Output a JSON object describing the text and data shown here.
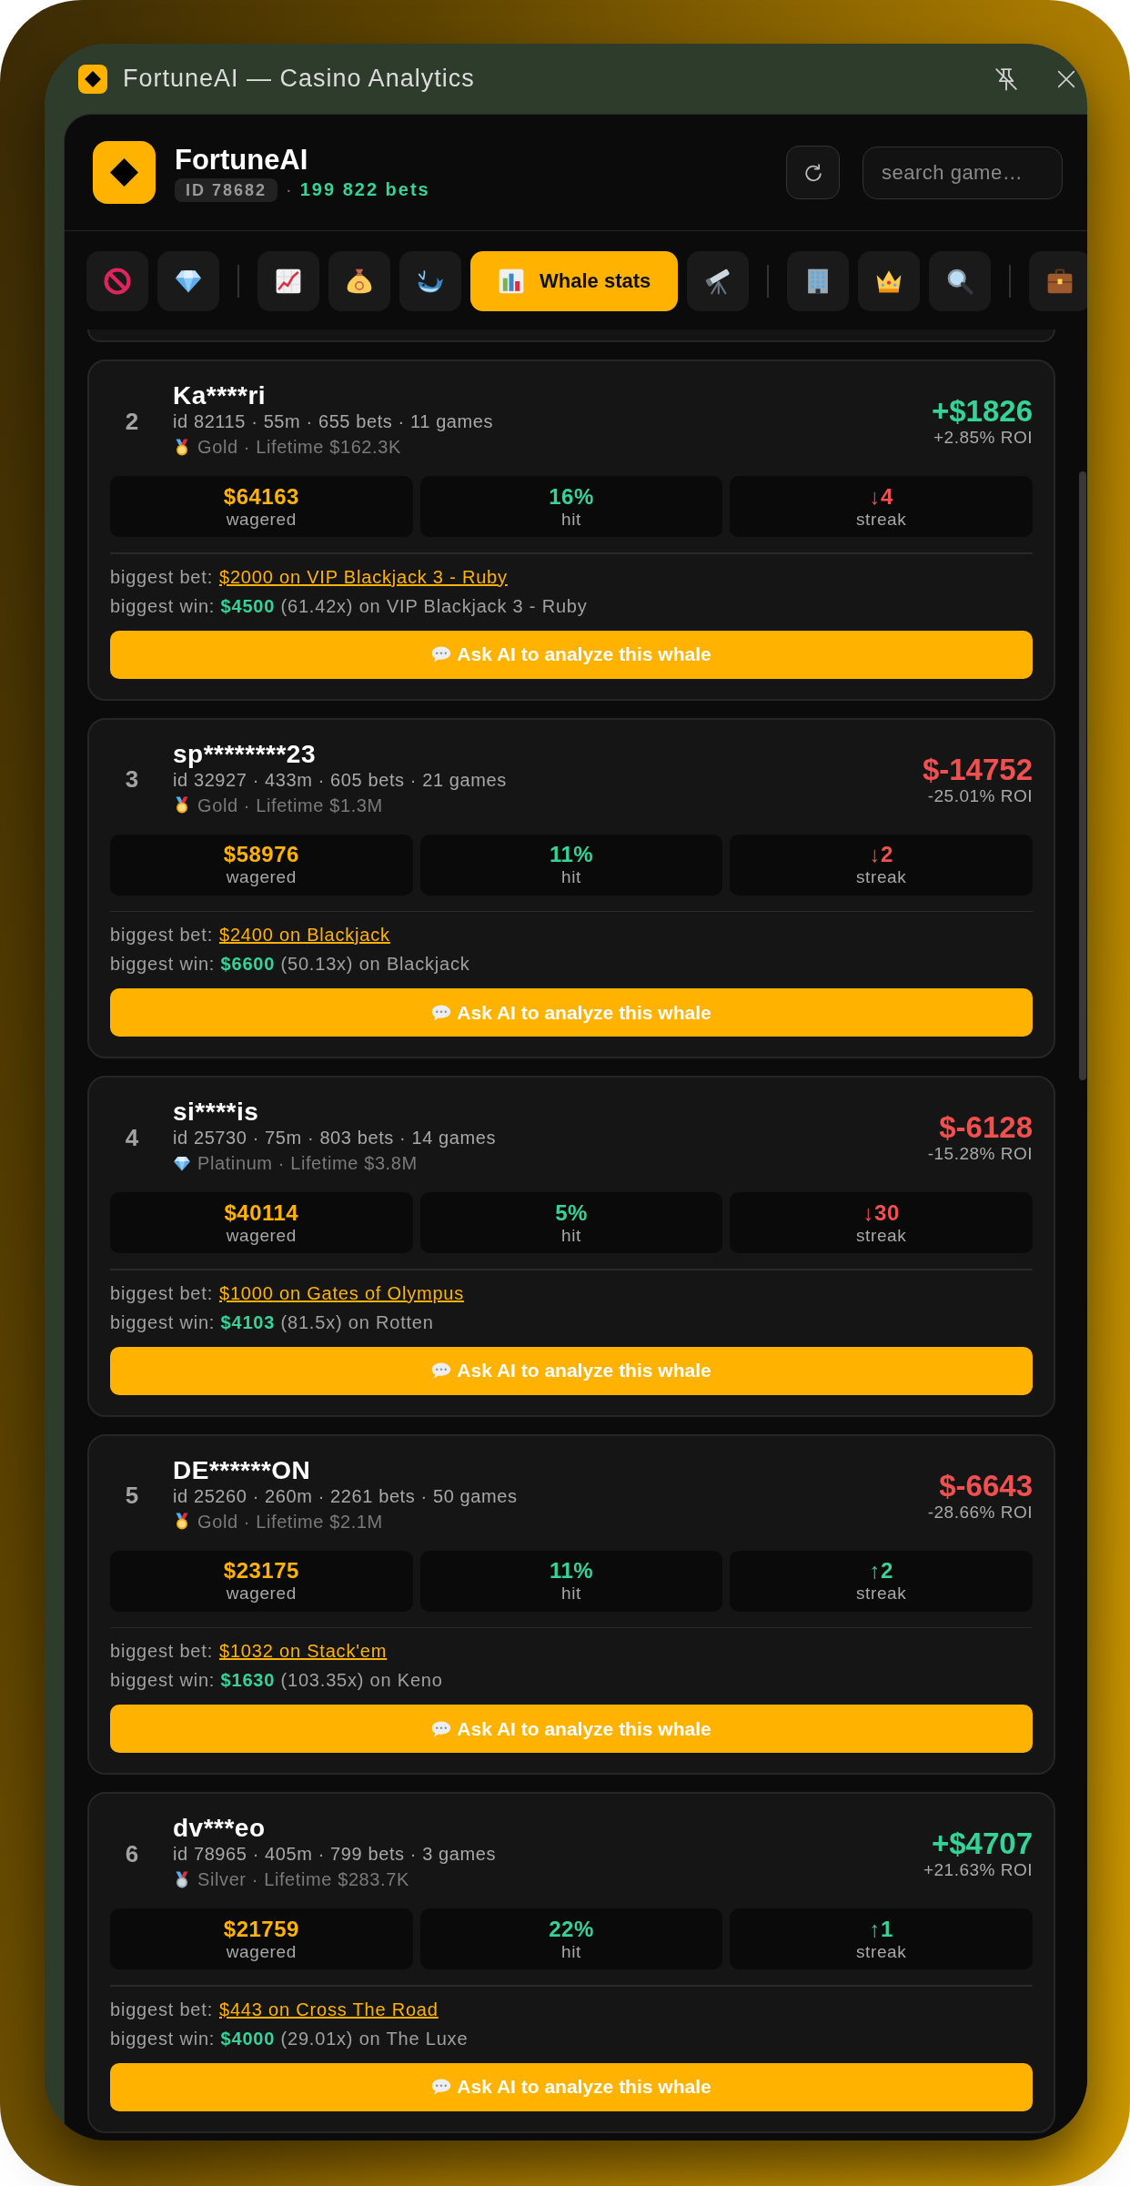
{
  "window": {
    "title": "FortuneAI — Casino Analytics"
  },
  "header": {
    "app_name": "FortuneAI",
    "id_badge": "ID 78682",
    "separator": "·",
    "bets": "199 822 bets",
    "search": {
      "placeholder": "search game…"
    }
  },
  "tab_groups": [
    {
      "tabs": [
        {
          "selected": false
        },
        {
          "selected": false
        }
      ]
    },
    {
      "tabs": [
        {
          "selected": false
        },
        {
          "selected": false
        },
        {
          "selected": false
        },
        {
          "label": "Whale stats",
          "selected": true
        },
        {
          "selected": false
        }
      ]
    },
    {
      "tabs": [
        {
          "selected": false
        },
        {
          "selected": false
        },
        {
          "selected": false
        }
      ]
    },
    {
      "tabs": [
        {
          "selected": false
        }
      ]
    }
  ],
  "whales": [
    {
      "rank": "2",
      "name": "Ka****ri",
      "meta": "id 82115 · 55m · 655 bets · 11 games",
      "tier": {
        "kind": "gold",
        "text": "Gold · Lifetime $162.3K"
      },
      "positive": true,
      "profit": "+$1826",
      "roi": "+2.85% ROI",
      "stats": [
        {
          "kind": "wagered",
          "value": "$64163",
          "label": "wagered"
        },
        {
          "kind": "hit",
          "value": "16%",
          "label": "hit"
        },
        {
          "kind": "streak",
          "rising": false,
          "value": "↓4",
          "label": "streak"
        }
      ],
      "biggest_bet": {
        "label": "biggest bet:",
        "link": "$2000 on VIP Blackjack 3 - Ruby"
      },
      "biggest_win": "biggest win: **$4500** (61.42x) on VIP Blackjack 3 - Ruby",
      "button": "Ask AI to analyze this whale"
    },
    {
      "rank": "3",
      "name": "sp********23",
      "meta": "id 32927 · 433m · 605 bets · 21 games",
      "tier": {
        "kind": "gold",
        "text": "Gold · Lifetime $1.3M"
      },
      "positive": false,
      "profit": "$-14752",
      "roi": "-25.01% ROI",
      "stats": [
        {
          "kind": "wagered",
          "value": "$58976",
          "label": "wagered"
        },
        {
          "kind": "hit",
          "value": "11%",
          "label": "hit"
        },
        {
          "kind": "streak",
          "rising": false,
          "value": "↓2",
          "label": "streak"
        }
      ],
      "biggest_bet": {
        "label": "biggest bet:",
        "link": "$2400 on Blackjack"
      },
      "biggest_win": "biggest win: **$6600** (50.13x) on Blackjack",
      "button": "Ask AI to analyze this whale"
    },
    {
      "rank": "4",
      "name": "si****is",
      "meta": "id 25730 · 75m · 803 bets · 14 games",
      "tier": {
        "kind": "platinum",
        "text": "Platinum · Lifetime $3.8M"
      },
      "positive": false,
      "profit": "$-6128",
      "roi": "-15.28% ROI",
      "stats": [
        {
          "kind": "wagered",
          "value": "$40114",
          "label": "wagered"
        },
        {
          "kind": "hit",
          "value": "5%",
          "label": "hit"
        },
        {
          "kind": "streak",
          "rising": false,
          "value": "↓30",
          "label": "streak"
        }
      ],
      "biggest_bet": {
        "label": "biggest bet:",
        "link": "$1000 on Gates of Olympus"
      },
      "biggest_win": "biggest win: **$4103** (81.5x) on Rotten",
      "button": "Ask AI to analyze this whale"
    },
    {
      "rank": "5",
      "name": "DE******ON",
      "meta": "id 25260 · 260m · 2261 bets · 50 games",
      "tier": {
        "kind": "gold",
        "text": "Gold · Lifetime $2.1M"
      },
      "positive": false,
      "profit": "$-6643",
      "roi": "-28.66% ROI",
      "stats": [
        {
          "kind": "wagered",
          "value": "$23175",
          "label": "wagered"
        },
        {
          "kind": "hit",
          "value": "11%",
          "label": "hit"
        },
        {
          "kind": "streak",
          "rising": true,
          "value": "↑2",
          "label": "streak"
        }
      ],
      "biggest_bet": {
        "label": "biggest bet:",
        "link": "$1032 on Stack'em"
      },
      "biggest_win": "biggest win: **$1630** (103.35x) on Keno",
      "button": "Ask AI to analyze this whale"
    },
    {
      "rank": "6",
      "name": "dv***eo",
      "meta": "id 78965 · 405m · 799 bets · 3 games",
      "tier": {
        "kind": "silver",
        "text": "Silver · Lifetime $283.7K"
      },
      "positive": true,
      "profit": "+$4707",
      "roi": "+21.63% ROI",
      "stats": [
        {
          "kind": "wagered",
          "value": "$21759",
          "label": "wagered"
        },
        {
          "kind": "hit",
          "value": "22%",
          "label": "hit"
        },
        {
          "kind": "streak",
          "rising": true,
          "value": "↑1",
          "label": "streak"
        }
      ],
      "biggest_bet": {
        "label": "biggest bet:",
        "link": "$443 on Cross The Road"
      },
      "biggest_win": "biggest win: **$4000** (29.01x) on The Luxe",
      "button": "Ask AI to analyze this whale"
    }
  ]
}
